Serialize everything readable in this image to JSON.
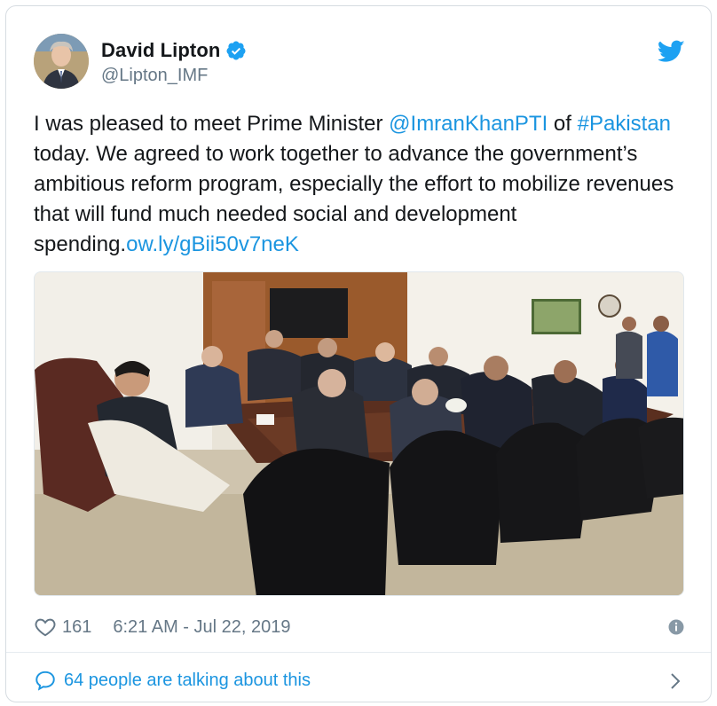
{
  "author": {
    "name": "David Lipton",
    "handle": "@Lipton_IMF",
    "verified": true
  },
  "tweet": {
    "segments": [
      {
        "type": "text",
        "value": "I was pleased to meet Prime Minister "
      },
      {
        "type": "link",
        "value": "@ImranKhanPTI"
      },
      {
        "type": "text",
        "value": " of "
      },
      {
        "type": "link",
        "value": "#Pakistan"
      },
      {
        "type": "text",
        "value": " today. We agreed to work together to advance the government’s ambitious reform program, especially the effort to mobilize revenues that will fund much needed social and development spending."
      },
      {
        "type": "link",
        "value": "ow.ly/gBii50v7neK"
      }
    ]
  },
  "meta": {
    "likes": "161",
    "timestamp": "6:21 AM - Jul 22, 2019"
  },
  "footer": {
    "talking_text": "64 people are talking about this"
  },
  "icons": {
    "verified": "verified-badge-icon",
    "twitter": "twitter-bird-icon",
    "like": "heart-icon",
    "info": "info-icon",
    "reply": "speech-bubble-icon",
    "chevron": "chevron-right-icon"
  },
  "colors": {
    "link": "#1b95e0",
    "muted": "#657786",
    "text": "#14171a",
    "twitter_blue": "#1da1f2"
  }
}
